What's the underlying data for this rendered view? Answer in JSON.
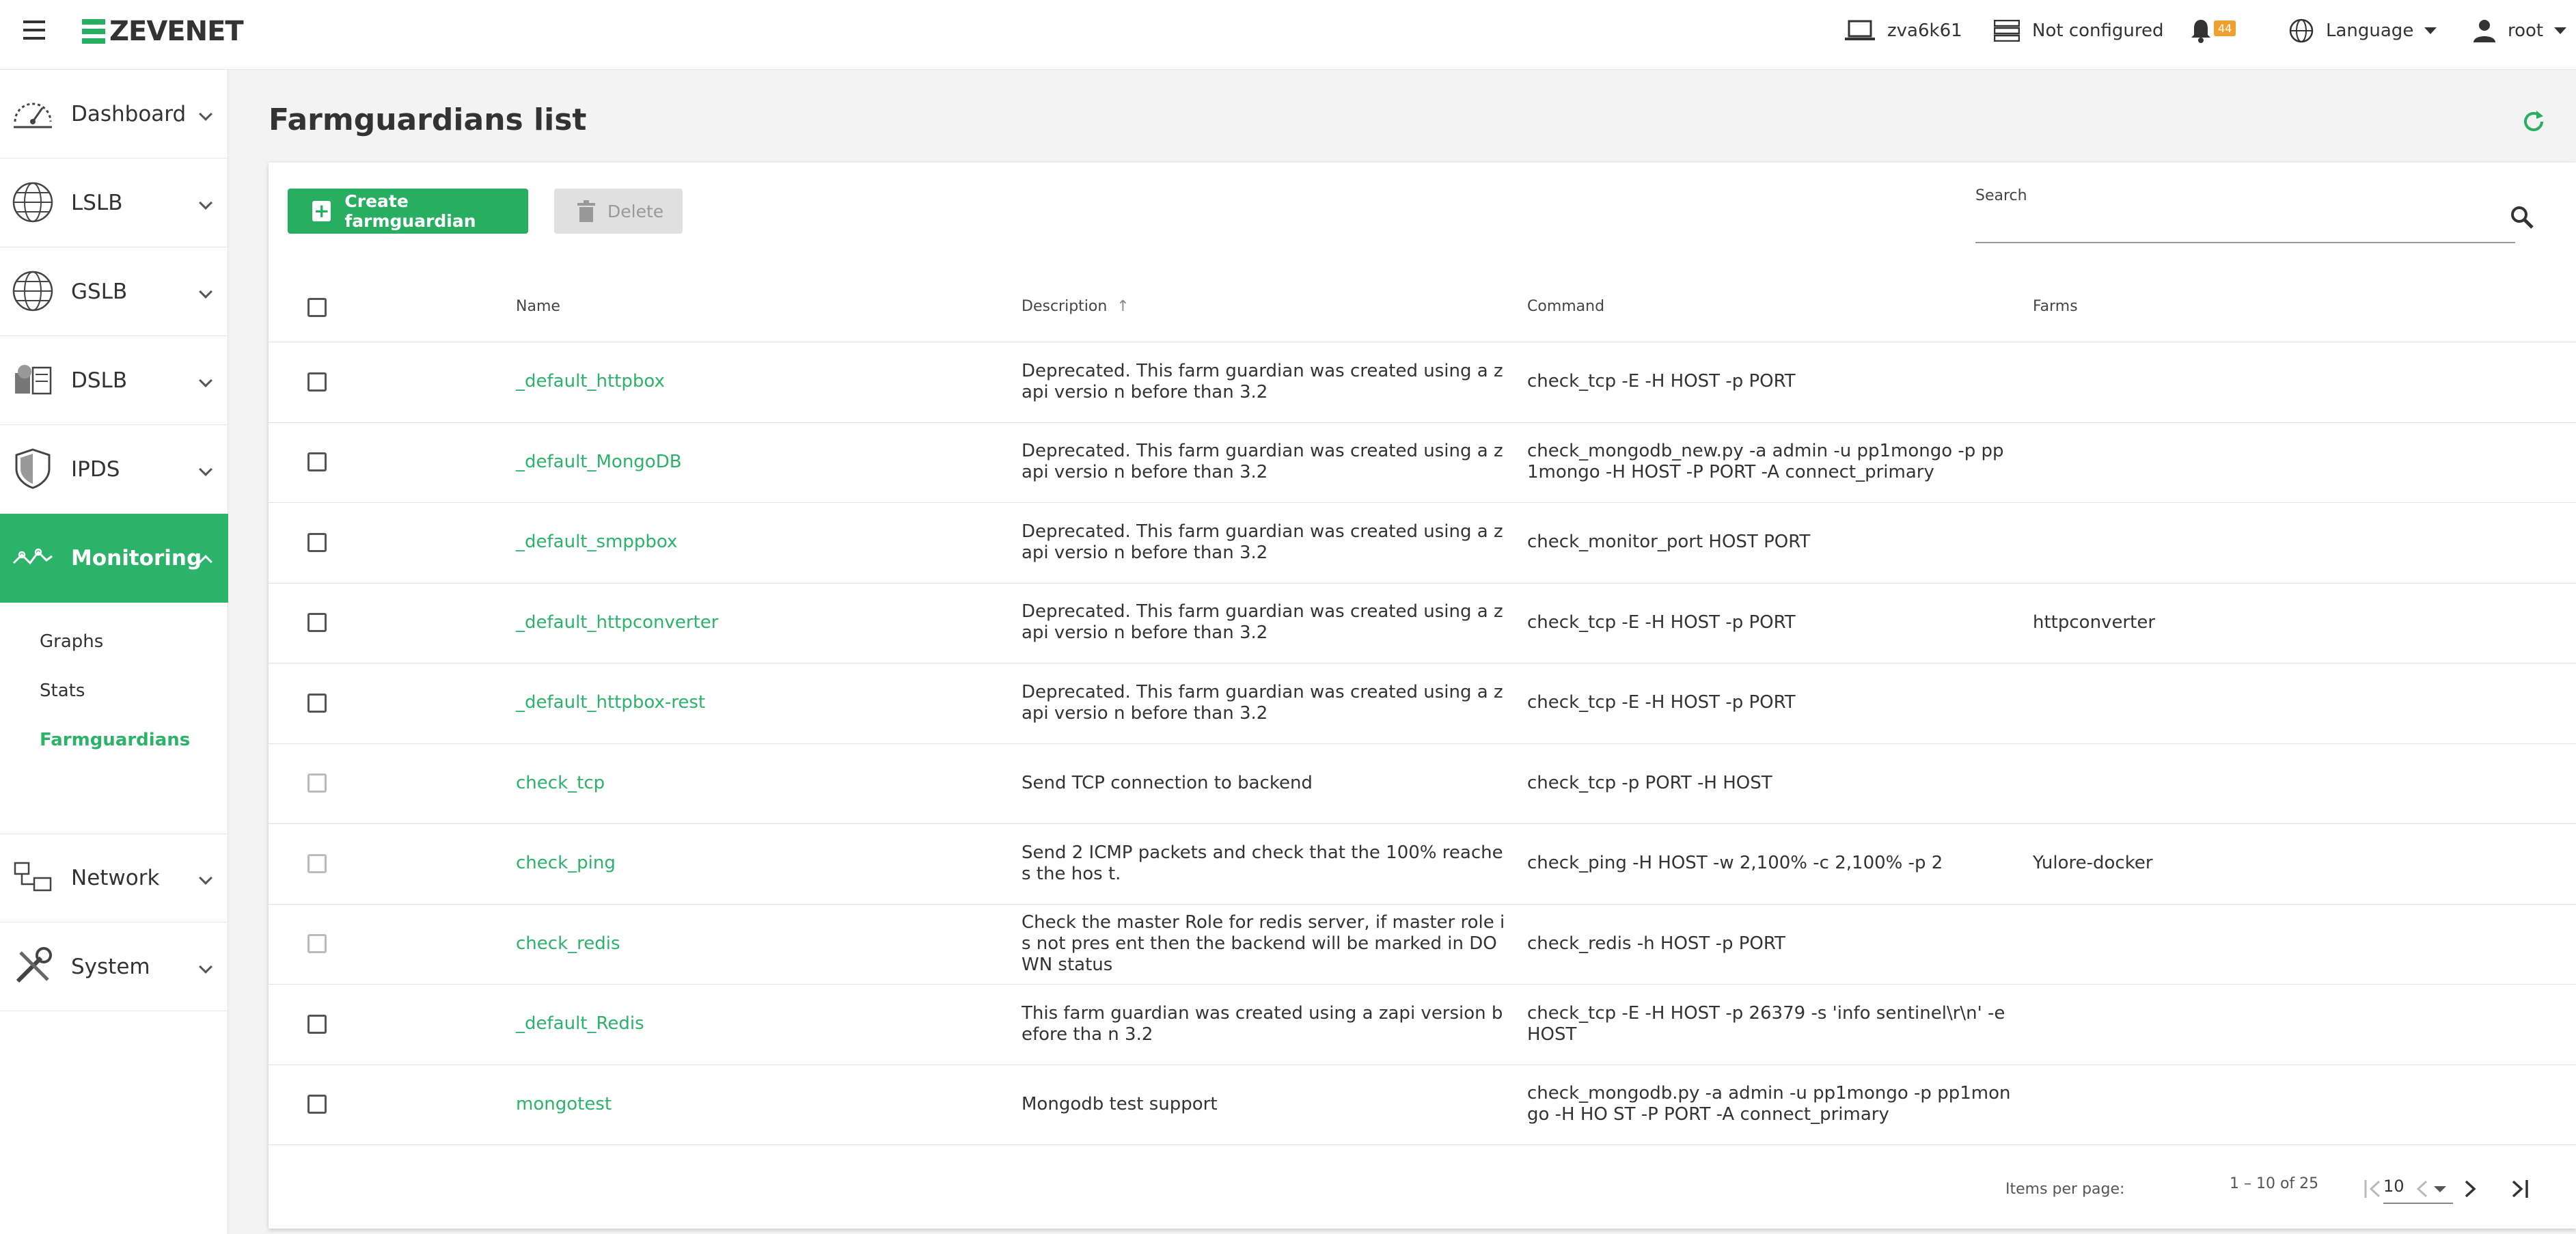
{
  "header": {
    "brand": "ZEVENET",
    "host": "zva6k61",
    "cluster": "Not configured",
    "notifications": "44",
    "language": "Language",
    "user": "root"
  },
  "sidebar": {
    "items": [
      {
        "label": "Dashboard",
        "icon": "dashboard-icon"
      },
      {
        "label": "LSLB",
        "icon": "globe-icon"
      },
      {
        "label": "GSLB",
        "icon": "globe-icon"
      },
      {
        "label": "DSLB",
        "icon": "datacenter-icon"
      },
      {
        "label": "IPDS",
        "icon": "shield-icon"
      },
      {
        "label": "Monitoring",
        "icon": "monitoring-icon"
      },
      {
        "label": "Network",
        "icon": "network-icon"
      },
      {
        "label": "System",
        "icon": "tools-icon"
      }
    ],
    "monitoring_sub": [
      "Graphs",
      "Stats",
      "Farmguardians"
    ]
  },
  "page": {
    "title": "Farmguardians list",
    "create_label": "Create farmguardian",
    "delete_label": "Delete",
    "search_label": "Search",
    "search_value": ""
  },
  "table": {
    "columns": [
      "Name",
      "Description",
      "Command",
      "Farms"
    ],
    "rows": [
      {
        "name": "_default_httpbox",
        "desc": "Deprecated. This farm guardian was created using a zapi versio n before than 3.2",
        "cmd": "check_tcp -E -H HOST -p PORT",
        "farms": ""
      },
      {
        "name": "_default_MongoDB",
        "desc": "Deprecated. This farm guardian was created using a zapi versio n before than 3.2",
        "cmd": "check_mongodb_new.py -a admin -u pp1mongo -p pp1mongo -H HOST -P PORT -A connect_primary",
        "farms": ""
      },
      {
        "name": "_default_smppbox",
        "desc": "Deprecated. This farm guardian was created using a zapi versio n before than 3.2",
        "cmd": "check_monitor_port HOST PORT",
        "farms": ""
      },
      {
        "name": "_default_httpconverter",
        "desc": "Deprecated. This farm guardian was created using a zapi versio n before than 3.2",
        "cmd": "check_tcp -E -H HOST -p PORT",
        "farms": "httpconverter"
      },
      {
        "name": "_default_httpbox-rest",
        "desc": "Deprecated. This farm guardian was created using a zapi versio n before than 3.2",
        "cmd": "check_tcp -E -H HOST -p PORT",
        "farms": ""
      },
      {
        "name": "check_tcp",
        "desc": "Send TCP connection to backend",
        "cmd": "check_tcp -p PORT -H HOST",
        "farms": ""
      },
      {
        "name": "check_ping",
        "desc": "Send 2 ICMP packets and check that the 100% reaches the hos t.",
        "cmd": "check_ping -H HOST -w 2,100% -c 2,100% -p 2",
        "farms": "Yulore-docker"
      },
      {
        "name": "check_redis",
        "desc": "Check the master Role for redis server, if master role is not pres ent then the backend will be marked in DOWN status",
        "cmd": "check_redis -h HOST -p PORT",
        "farms": ""
      },
      {
        "name": "_default_Redis",
        "desc": "This farm guardian was created using a zapi version before tha n 3.2",
        "cmd": "check_tcp -E -H HOST -p 26379 -s 'info sentinel\\r\\n' -e HOST",
        "farms": ""
      },
      {
        "name": "mongotest",
        "desc": "Mongodb test support",
        "cmd": "check_mongodb.py -a admin -u pp1mongo -p pp1mongo -H HO ST -P PORT -A connect_primary",
        "farms": ""
      }
    ]
  },
  "pagination": {
    "items_per_page_label": "Items per page:",
    "items_per_page": "10",
    "range": "1 – 10 of 25"
  },
  "colors": {
    "accent": "#2bb36a",
    "badge": "#f0a030"
  }
}
